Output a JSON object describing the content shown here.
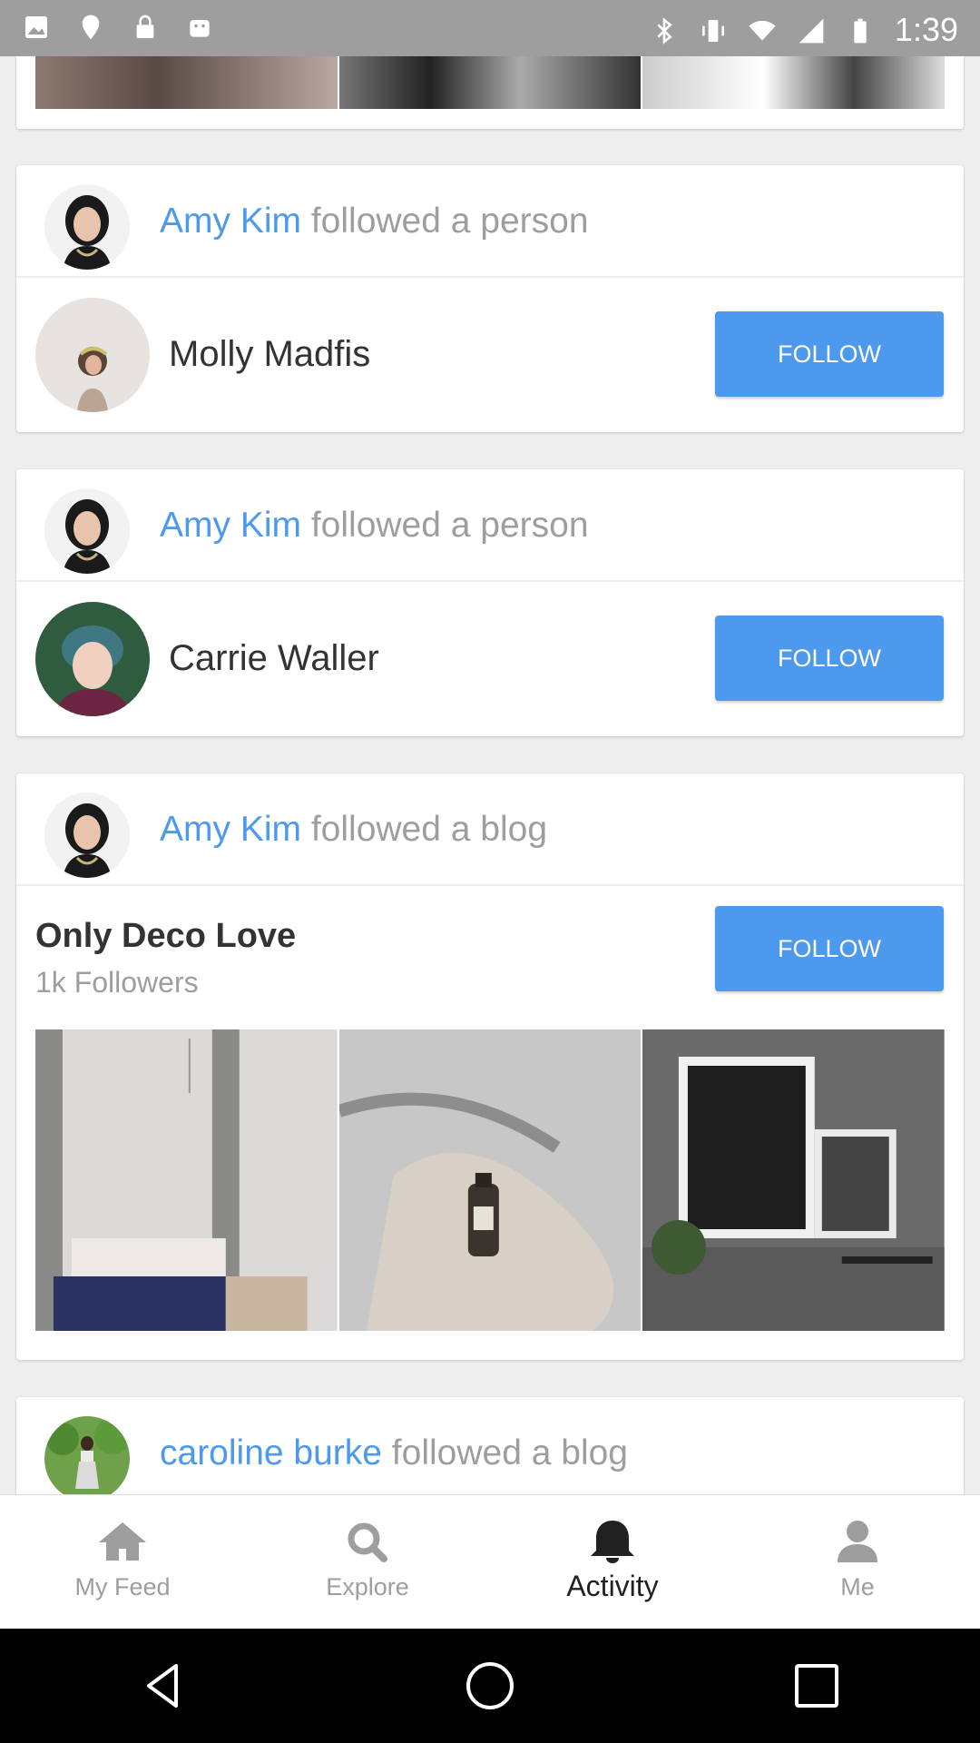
{
  "status_bar": {
    "time": "1:39",
    "left_icons": [
      "photo-icon",
      "fake-gps-icon",
      "lock-icon",
      "android-icon"
    ],
    "right_icons": [
      "bluetooth-icon",
      "vibrate-icon",
      "wifi-icon",
      "signal-icon",
      "battery-icon"
    ]
  },
  "feed": {
    "cards": [
      {
        "actor": "Amy Kim",
        "action": " followed a person",
        "person_name": "Molly Madfis",
        "follow_label": "FOLLOW"
      },
      {
        "actor": "Amy Kim",
        "action": " followed a person",
        "person_name": "Carrie Waller",
        "follow_label": "FOLLOW"
      },
      {
        "actor": "Amy Kim",
        "action": " followed a blog",
        "blog_title": "Only Deco Love",
        "blog_followers": "1k Followers",
        "follow_label": "FOLLOW"
      },
      {
        "actor": "caroline burke",
        "action": " followed a blog"
      }
    ]
  },
  "bottom_nav": {
    "items": [
      {
        "label": "My Feed",
        "icon": "home-icon"
      },
      {
        "label": "Explore",
        "icon": "search-icon"
      },
      {
        "label": "Activity",
        "icon": "bell-icon",
        "active": true
      },
      {
        "label": "Me",
        "icon": "person-icon"
      }
    ]
  },
  "colors": {
    "accent": "#4c99ee",
    "status_bar": "#9e9e9e",
    "muted_text": "#9e9e9e"
  }
}
